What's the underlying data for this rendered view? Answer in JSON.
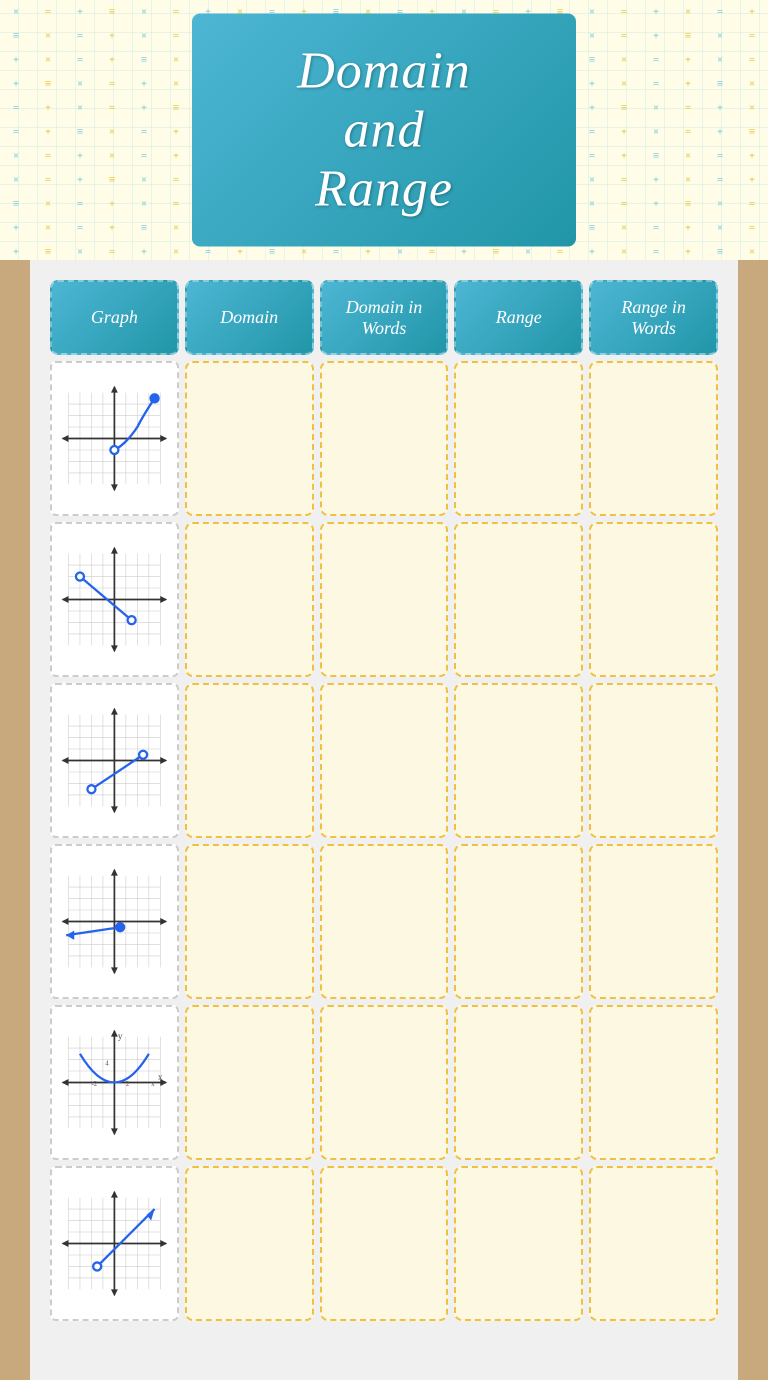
{
  "page": {
    "title": "Domain and Range"
  },
  "pattern": {
    "symbols": [
      "×",
      "=",
      "+",
      "×",
      "=",
      "+"
    ]
  },
  "header": {
    "columns": [
      {
        "label": "Graph"
      },
      {
        "label": "Domain"
      },
      {
        "label": "Domain in Words"
      },
      {
        "label": "Range"
      },
      {
        "label": "Range in Words"
      }
    ]
  },
  "rows": [
    {
      "id": 1,
      "graph_type": "parabola_right"
    },
    {
      "id": 2,
      "graph_type": "segment_down"
    },
    {
      "id": 3,
      "graph_type": "segment_left"
    },
    {
      "id": 4,
      "graph_type": "ray_left"
    },
    {
      "id": 5,
      "graph_type": "parabola_up"
    },
    {
      "id": 6,
      "graph_type": "ray_up_right"
    }
  ]
}
